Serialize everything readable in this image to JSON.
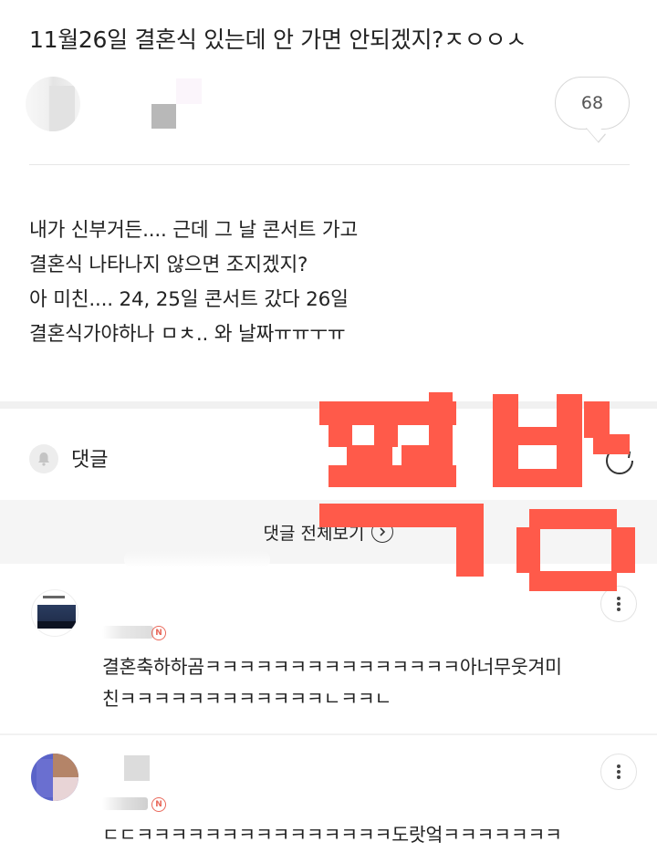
{
  "post": {
    "title": "11월26일 결혼식 있는데 안 가면 안되겠지?ㅈㅇㅇㅅ",
    "comment_count": "68",
    "body_lines": [
      "내가 신부거든.... 근데 그 날 콘서트 가고",
      "결혼식 나타나지 않으면 조지겠지?",
      "아 미친.... 24, 25일 콘서트 갔다 26일",
      "결혼식가야하나 ㅁㅊ.. 와 날짜ㅠㅠㅜㅠ"
    ]
  },
  "comments_section": {
    "label": "댓글",
    "view_all_label": "댓글 전체보기"
  },
  "comments": [
    {
      "text_lines": [
        "결혼축하하곰ㅋㅋㅋㅋㅋㅋㅋㅋㅋㅋㅋㅋㅋㅋㅋ아너무웃겨미",
        "친ㅋㅋㅋㅋㅋㅋㅋㅋㅋㅋㅋㅋㄴㅋㅋㄴ"
      ],
      "badge": "N"
    },
    {
      "text_lines": [
        "ㄷㄷㅋㅋㅋㅋㅋㅋㅋㅋㅋㅋㅋㅋㅋㅋㅋ도랏엌ㅋㅋㅋㅋㅋㅋㅋ"
      ],
      "badge": "N"
    }
  ],
  "overlay": {
    "stamp_color": "#ff5a4a"
  },
  "icons": {
    "bell": "bell-icon",
    "refresh": "refresh-icon",
    "chevron": "chevron-right-icon",
    "more": "more-vertical-icon"
  }
}
